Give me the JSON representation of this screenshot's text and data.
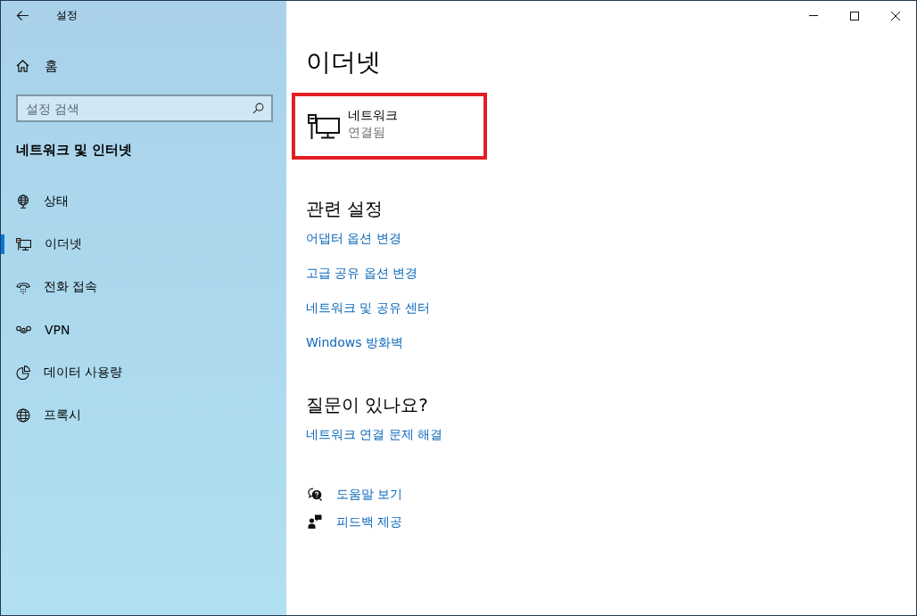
{
  "window": {
    "title": "설정"
  },
  "sidebar": {
    "home": "홈",
    "search": {
      "placeholder": "설정 검색"
    },
    "section_title": "네트워크 및 인터넷",
    "items": [
      {
        "label": "상태",
        "kind": "status",
        "selected": false
      },
      {
        "label": "이더넷",
        "kind": "ethernet",
        "selected": true
      },
      {
        "label": "전화 접속",
        "kind": "dialup",
        "selected": false
      },
      {
        "label": "VPN",
        "kind": "vpn",
        "selected": false
      },
      {
        "label": "데이터 사용량",
        "kind": "data_usage",
        "selected": false
      },
      {
        "label": "프록시",
        "kind": "proxy",
        "selected": false
      }
    ]
  },
  "page": {
    "title": "이더넷",
    "network": {
      "name": "네트워크",
      "status": "연결됨",
      "highlighted": true
    },
    "related": {
      "heading": "관련 설정",
      "links": [
        "어댑터 옵션 변경",
        "고급 공유 옵션 변경",
        "네트워크 및 공유 센터",
        "Windows 방화벽"
      ]
    },
    "questions": {
      "heading": "질문이 있나요?",
      "links": [
        "네트워크 연결 문제 해결"
      ]
    },
    "support_links": [
      {
        "label": "도움말 보기",
        "kind": "help"
      },
      {
        "label": "피드백 제공",
        "kind": "feedback"
      }
    ]
  }
}
